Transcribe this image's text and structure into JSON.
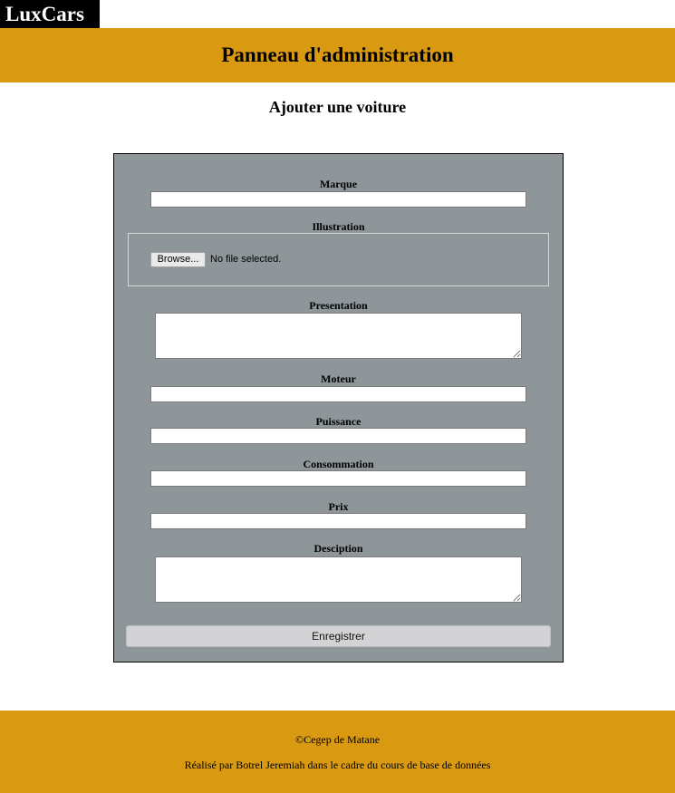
{
  "brand": {
    "logo": "LuxCars"
  },
  "header": {
    "title": "Panneau d'administration"
  },
  "page": {
    "subtitle": "Ajouter une voiture"
  },
  "form": {
    "marque": {
      "label": "Marque",
      "value": ""
    },
    "illustration": {
      "label": "Illustration",
      "browse_label": "Browse...",
      "status": "No file selected."
    },
    "presentation": {
      "label": "Presentation",
      "value": ""
    },
    "moteur": {
      "label": "Moteur",
      "value": ""
    },
    "puissance": {
      "label": "Puissance",
      "value": ""
    },
    "consommation": {
      "label": "Consommation",
      "value": ""
    },
    "prix": {
      "label": "Prix",
      "value": ""
    },
    "description": {
      "label": "Desciption",
      "value": ""
    },
    "submit_label": "Enregistrer"
  },
  "footer": {
    "copyright": "©Cegep de Matane",
    "credit": "Réalisé par Botrel Jeremiah dans le cadre du cours de base de données"
  },
  "colors": {
    "accent": "#d99a12",
    "form_bg": "#8f9699",
    "logo_bg": "#000000"
  }
}
